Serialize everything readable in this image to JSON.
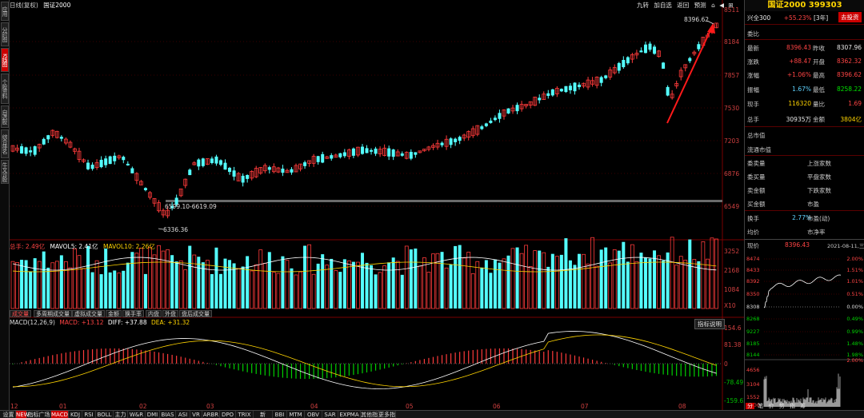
{
  "left_tabs": [
    "应用",
    "分时图",
    "K线图",
    "个股资料",
    "自选股",
    "综合排名",
    "牛叉诊股"
  ],
  "chart_header": {
    "period": "日线(复权)",
    "symbol": "国证2000",
    "tools": [
      "九转",
      "加自选",
      "返回",
      "预测"
    ]
  },
  "price_axis": [
    "8511",
    "8184",
    "7857",
    "7530",
    "7203",
    "6876",
    "6549"
  ],
  "annotations": {
    "high_label": "8396.62",
    "low_label": "6336.36",
    "band_label": "6599.10-6619.09"
  },
  "volume_panel": {
    "title": "总手: 2.49亿",
    "ma5": "MAVOL5: 2.41亿",
    "ma10": "MAVOL10: 2.26亿",
    "axis": [
      "3252",
      "2168",
      "1084",
      "X10"
    ]
  },
  "indicator_tabs": [
    "成交量",
    "多周期成交量",
    "虚拟成交量",
    "金额",
    "换手率",
    "内盘",
    "外盘",
    "盘后成交量"
  ],
  "macd_panel": {
    "params": "MACD(12,26,9)",
    "macd": "MACD: +13.12",
    "diff": "DIFF: +37.88",
    "dea": "DEA: +31.32",
    "help": "指标说明",
    "axis": [
      "154.6",
      "81.38",
      "0",
      "-78.49",
      "-159.63"
    ]
  },
  "time_axis": [
    "12",
    "01",
    "02",
    "03",
    "04",
    "05",
    "06",
    "07",
    "08"
  ],
  "bottom_tabs": [
    "设置",
    "NEW",
    "指标广场",
    "MACD",
    "KDJ",
    "RSI",
    "BOLL",
    "主力",
    "W&R",
    "DMI",
    "BIAS",
    "ASI",
    "VR",
    "ARBR",
    "DPO",
    "TRIX",
    "新DMA",
    "BBI",
    "MTM",
    "OBV",
    "SAR",
    "EXPMA",
    "其他指标",
    "更多指标"
  ],
  "quote": {
    "title": "国证2000 399303",
    "sector": "兴全300",
    "sector_change": "+55.23%",
    "sector_period": "[3年]",
    "sell_btn": "去投资",
    "weibi_label": "委比",
    "rows": [
      {
        "l1": "最新",
        "v1": "8396.43",
        "l2": "昨收",
        "v2": "8307.96",
        "c1": "red",
        "c2": "white"
      },
      {
        "l1": "涨跌",
        "v1": "+88.47",
        "l2": "开盘",
        "v2": "8362.32",
        "c1": "red",
        "c2": "red"
      },
      {
        "l1": "涨幅",
        "v1": "+1.06%",
        "l2": "最高",
        "v2": "8396.62",
        "c1": "red",
        "c2": "red"
      },
      {
        "l1": "振幅",
        "v1": "1.67%",
        "l2": "最低",
        "v2": "8258.22",
        "c1": "cyan",
        "c2": "green"
      },
      {
        "l1": "现手",
        "v1": "116320",
        "l2": "量比",
        "v2": "1.69",
        "c1": "yellow",
        "c2": "red"
      },
      {
        "l1": "总手",
        "v1": "30935万",
        "l2": "金额",
        "v2": "3804亿",
        "c1": "white",
        "c2": "yellow"
      }
    ],
    "total_mv": "总市值",
    "float_mv": "流通市值",
    "breadth": [
      {
        "l": "委卖量",
        "r": "上涨家数"
      },
      {
        "l": "委买量",
        "r": "平盘家数"
      },
      {
        "l": "卖金额",
        "r": "下跌家数"
      },
      {
        "l": "买金额",
        "r": "市盈"
      }
    ],
    "turnover_label": "换手",
    "turnover": "2.77%",
    "pe_dyn": "市盈(动)",
    "avg_label": "均价",
    "pb": "市净率"
  },
  "intraday": {
    "price_label": "现价",
    "price": "8396.43",
    "date": "2021-08-11,三",
    "price_axis": [
      "8474",
      "8433",
      "8392",
      "8350",
      "8308",
      "8268",
      "9227",
      "8185",
      "8144"
    ],
    "pct_axis": [
      "2.00%",
      "1.51%",
      "1.01%",
      "0.51%",
      "0.00%",
      "0.49%",
      "0.99%",
      "1.48%",
      "1.98%"
    ],
    "vol_axis": [
      "4656",
      "3104",
      "1552",
      "X100"
    ],
    "vol_pct": "2.00%",
    "tabs": [
      "分",
      "笔",
      "价",
      "势",
      "指",
      "筹"
    ]
  }
}
